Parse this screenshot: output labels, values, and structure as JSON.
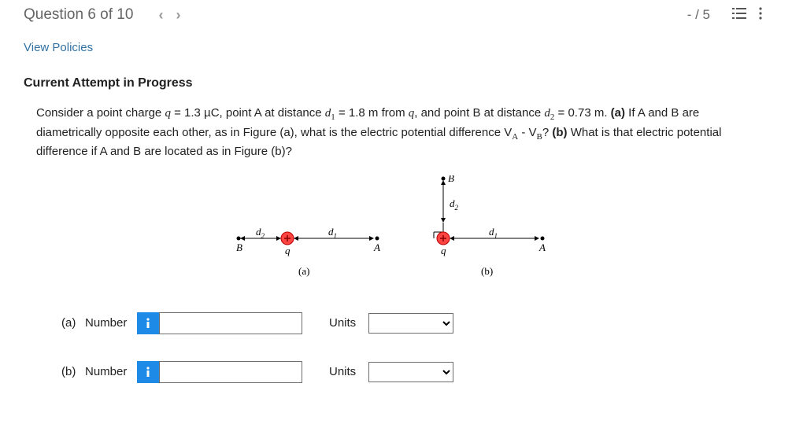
{
  "header": {
    "title": "Question 6 of 10",
    "prev_glyph": "‹",
    "next_glyph": "›",
    "score": "- / 5",
    "list_icon": "list-icon",
    "menu_icon": "kebab-icon"
  },
  "links": {
    "view_policies": "View Policies"
  },
  "section": {
    "title": "Current Attempt in Progress"
  },
  "problem": {
    "lead": "Consider a point charge ",
    "q_eq": "q = 1.3 µC, point A at distance ",
    "d1_eq": " = 1.8 m from ",
    "mid1": ", and point B at distance ",
    "d2_eq": " = 0.73 m. ",
    "part_a_bold": "(a)",
    "part_a_txt": " If A and B are diametrically opposite each other, as in Figure (a), what is the electric potential difference V",
    "minus": " - V",
    "part_a_end": "? ",
    "part_b_bold": "(b)",
    "part_b_txt": " What is that electric potential difference if A and B are located as in Figure (b)?"
  },
  "figure": {
    "A": "A",
    "B": "B",
    "q": "q",
    "d1": "d",
    "d2": "d",
    "one": "1",
    "two": "2",
    "cap_a": "(a)",
    "cap_b": "(b)"
  },
  "answers": {
    "a": {
      "part": "(a)",
      "label": "Number",
      "units_label": "Units",
      "value": "",
      "units_value": ""
    },
    "b": {
      "part": "(b)",
      "label": "Number",
      "units_label": "Units",
      "value": "",
      "units_value": ""
    }
  }
}
